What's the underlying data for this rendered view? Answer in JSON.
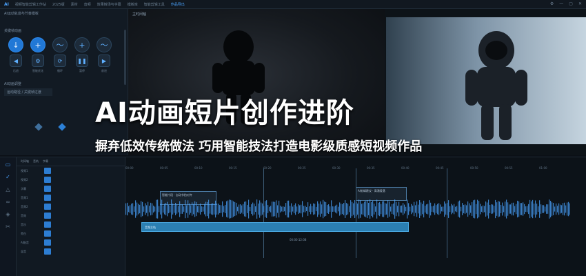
{
  "app": {
    "logo": "AI",
    "title": "视频智能剪辑工作站",
    "version": "2025版",
    "menu_tabs": [
      "素材",
      "音频",
      "效果转场与字幕",
      "模板库",
      "智能剪辑工具",
      "作品导出"
    ],
    "window_controls": [
      "⚙",
      "—",
      "▢",
      "✕"
    ]
  },
  "left_panel": {
    "section1_title": "AI运动轨迹与节奏模板",
    "section2_title": "关键帧动画",
    "section3_title": "AI动画调整",
    "dropdown_label": "运动路径 / 关键帧过渡",
    "row1_icons": [
      "download-icon",
      "plus-icon",
      "wave-icon",
      "plus-icon",
      "wave-icon"
    ],
    "row2_icons": [
      "rewind-icon",
      "settings-icon",
      "loop-icon",
      "pause-icon",
      "forward-icon"
    ],
    "row2_labels": [
      "后退",
      "智能优化",
      "循环",
      "暂停",
      "前进"
    ]
  },
  "viewer": {
    "left_title": "主时间轴",
    "headline": "AI动画短片创作进阶",
    "subline": "摒弃低效传统做法 巧用智能技法打造电影级质感短视频作品"
  },
  "timeline": {
    "header": [
      "时间轴",
      "音轨",
      "字幕"
    ],
    "tool_icons": [
      "pointer-icon",
      "check-icon",
      "triangle-icon",
      "link-icon",
      "marker-icon",
      "cut-icon"
    ],
    "tracks": [
      "视频1",
      "视频2",
      "字幕",
      "音频1",
      "音频2",
      "音效",
      "音乐",
      "旁白",
      "AI配音",
      "混音"
    ],
    "ruler_ticks": [
      "00:00",
      "00:05",
      "00:10",
      "00:15",
      "00:20",
      "00:25",
      "00:30",
      "00:35",
      "00:40",
      "00:45",
      "00:50",
      "00:55",
      "01:00"
    ],
    "note1": "智能片段 · 自动节拍对齐",
    "note2": "AI剪辑建议 · 高潮段落",
    "clip_label": "音频主轨",
    "timecode": "00:00:12:08"
  },
  "colors": {
    "accent": "#2e8bf0",
    "wave": "#4aa3ff",
    "clip": "#2b7fb2"
  }
}
